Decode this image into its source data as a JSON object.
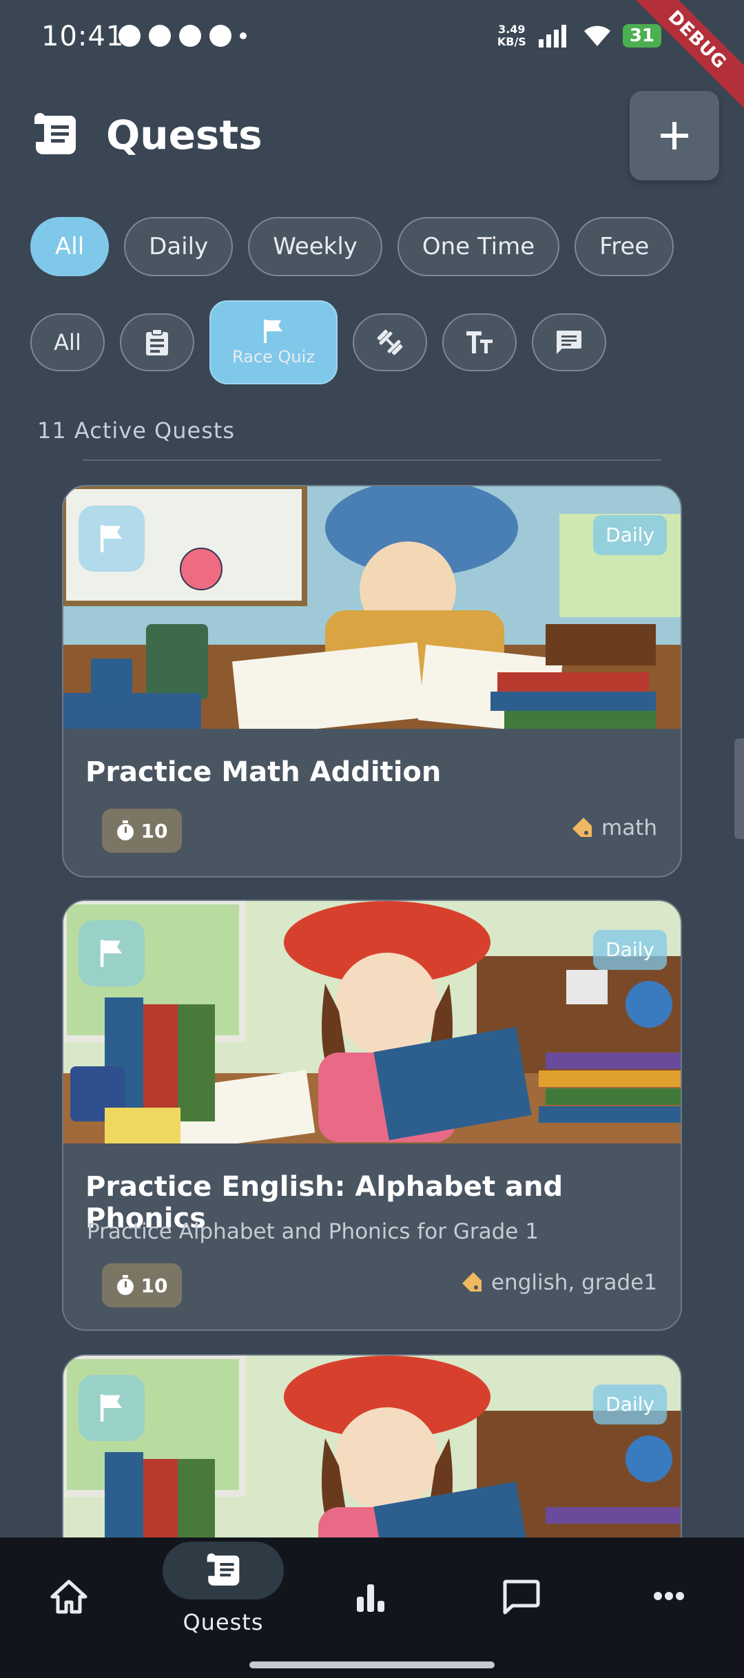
{
  "status_bar": {
    "time": "10:41",
    "net_speed": "3.49",
    "net_unit": "KB/S",
    "battery": "31",
    "debug_label": "DEBUG"
  },
  "header": {
    "title": "Quests",
    "header_icon": "scroll-icon",
    "add_icon": "plus-icon"
  },
  "frequency_filters": [
    {
      "label": "All",
      "selected": true
    },
    {
      "label": "Daily",
      "selected": false
    },
    {
      "label": "Weekly",
      "selected": false
    },
    {
      "label": "One Time",
      "selected": false
    },
    {
      "label": "Free",
      "selected": false
    }
  ],
  "type_filters": [
    {
      "label": "All",
      "icon": null,
      "selected": false
    },
    {
      "label": "",
      "icon": "clipboard-icon",
      "selected": false
    },
    {
      "label": "Race Quiz",
      "icon": "flag-icon",
      "selected": true
    },
    {
      "label": "",
      "icon": "dumbbell-icon",
      "selected": false
    },
    {
      "label": "",
      "icon": "text-size-icon",
      "selected": false
    },
    {
      "label": "",
      "icon": "chat-icon",
      "selected": false
    }
  ],
  "active_count": "11 Active Quests",
  "quests": [
    {
      "title": "Practice Math Addition",
      "subtitle": "",
      "frequency": "Daily",
      "timer": "10",
      "tags": "math",
      "type_icon": "flag-icon"
    },
    {
      "title": "Practice English: Alphabet and Phonics",
      "subtitle": "Practice Alphabet and Phonics for Grade 1",
      "frequency": "Daily",
      "timer": "10",
      "tags": "english, grade1",
      "type_icon": "flag-icon"
    },
    {
      "title": "",
      "subtitle": "",
      "frequency": "Daily",
      "timer": "",
      "tags": "",
      "type_icon": "flag-icon"
    }
  ],
  "bottom_nav": [
    {
      "label": "",
      "icon": "home-icon",
      "active": false
    },
    {
      "label": "Quests",
      "icon": "scroll-icon",
      "active": true
    },
    {
      "label": "",
      "icon": "bar-chart-icon",
      "active": false
    },
    {
      "label": "",
      "icon": "chat-icon",
      "active": false
    },
    {
      "label": "",
      "icon": "more-icon",
      "active": false
    }
  ]
}
